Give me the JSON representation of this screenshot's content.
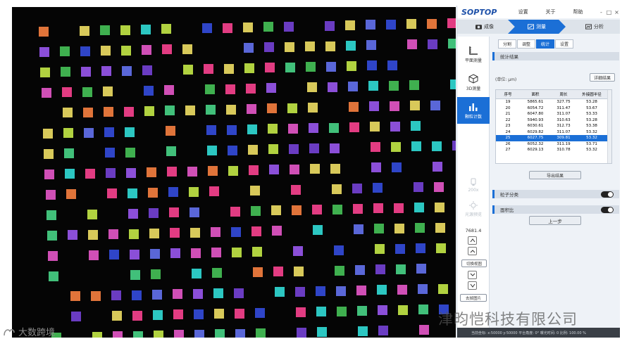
{
  "app": {
    "logo": "SOPTOP",
    "menu": [
      "设置",
      "关于",
      "帮助"
    ],
    "window_controls": [
      "-",
      "□",
      "×"
    ]
  },
  "steps": [
    {
      "label": "成像",
      "active": false
    },
    {
      "label": "测量",
      "active": true
    },
    {
      "label": "分析",
      "active": false
    }
  ],
  "sidebar": {
    "tools": [
      {
        "label": "平面测量",
        "icon": "ruler-icon",
        "active": false
      },
      {
        "label": "3D测量",
        "icon": "cube-icon",
        "active": false
      },
      {
        "label": "颗粒计数",
        "icon": "bar-chart-icon",
        "active": true
      }
    ],
    "disabled_tools": [
      {
        "label": "200x"
      },
      {
        "label": "光源预览"
      }
    ],
    "zoom_value": "7681.4",
    "buttons": [
      "切换视图",
      "去掉图片"
    ]
  },
  "tabs": [
    {
      "label": "分割",
      "active": false
    },
    {
      "label": "调整",
      "active": false
    },
    {
      "label": "统计",
      "active": true
    },
    {
      "label": "设置",
      "active": false
    }
  ],
  "stats": {
    "section_title": "统计结果",
    "unit": "(单位: μm)",
    "detail_button": "详细结果",
    "columns": [
      "序号",
      "面积",
      "周长",
      "外接圆半径"
    ],
    "rows": [
      {
        "id": "19",
        "area": "5865.61",
        "perimeter": "327.75",
        "radius": "53.28",
        "selected": false
      },
      {
        "id": "20",
        "area": "6054.72",
        "perimeter": "311.47",
        "radius": "53.67",
        "selected": false
      },
      {
        "id": "21",
        "area": "6047.80",
        "perimeter": "311.07",
        "radius": "53.33",
        "selected": false
      },
      {
        "id": "22",
        "area": "5940.93",
        "perimeter": "310.63",
        "radius": "53.28",
        "selected": false
      },
      {
        "id": "23",
        "area": "6030.61",
        "perimeter": "312.73",
        "radius": "53.38",
        "selected": false
      },
      {
        "id": "24",
        "area": "6029.82",
        "perimeter": "311.07",
        "radius": "53.32",
        "selected": false
      },
      {
        "id": "25",
        "area": "6027.75",
        "perimeter": "309.81",
        "radius": "53.32",
        "selected": true
      },
      {
        "id": "26",
        "area": "6052.32",
        "perimeter": "311.19",
        "radius": "53.71",
        "selected": false
      },
      {
        "id": "27",
        "area": "6029.13",
        "perimeter": "310.78",
        "radius": "53.32",
        "selected": false
      }
    ],
    "export_button": "导出结果"
  },
  "options": [
    {
      "label": "粒子分类",
      "on": false
    },
    {
      "label": "面积比",
      "on": false
    }
  ],
  "prev_button": "上一步",
  "status_bar": "当前坐标: x:50000  y:50000  平台角度: 0°  曝光时间: 0  比例: 100.00 %",
  "watermark": {
    "company": "津昀恺科技有限公司",
    "channel": "大数跨境"
  },
  "colors": {
    "accent": "#1b6fd6",
    "viewport_bg": "#050505",
    "panel_bg": "#eef2f7"
  },
  "particle_palette": [
    "#3fb04f",
    "#e23c82",
    "#2f45c8",
    "#2cc7c2",
    "#8b4fd8",
    "#d8c95a",
    "#e0743a",
    "#b1d240",
    "#5a67d8",
    "#d04fb6",
    "#41c07a",
    "#6a3cc2"
  ]
}
